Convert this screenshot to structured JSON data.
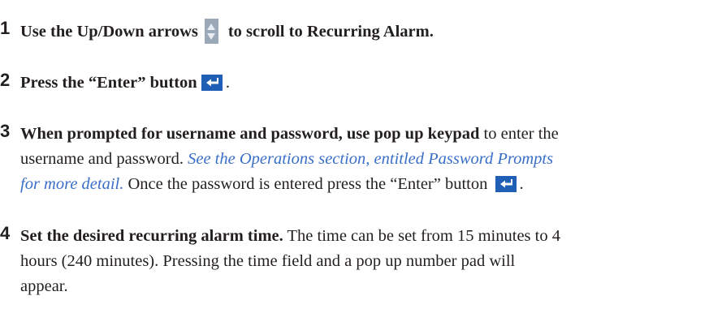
{
  "steps": [
    {
      "number": "1",
      "text_a": "Use the Up/Down arrows",
      "text_b": "to scroll to Recurring Alarm."
    },
    {
      "number": "2",
      "text_a": "Press the “Enter” button",
      "text_b": "."
    },
    {
      "number": "3",
      "bold_a": "When prompted for username and password, use pop up keypad",
      "text_a": " to enter the",
      "line2_a": "username and password.  ",
      "link_a": "See the Operations section, entitled Password Prompts",
      "link_b": "for more detail.",
      "line3_b": " Once the password is entered press the “Enter” button ",
      "line3_c": "."
    },
    {
      "number": "4",
      "bold_a": "Set the desired recurring alarm time.",
      "text_a": " The time can be set from 15 minutes to 4",
      "line2": "hours (240 minutes).  Pressing the time field and a pop up number pad will",
      "line3": "appear."
    }
  ],
  "colors": {
    "text": "#231f20",
    "link": "#3a6fc8",
    "enter_button": "#1f5fb5",
    "updown_button": "#9aa8b8"
  },
  "icons": {
    "updown": "up-down-arrows-icon",
    "enter": "enter-key-icon"
  }
}
